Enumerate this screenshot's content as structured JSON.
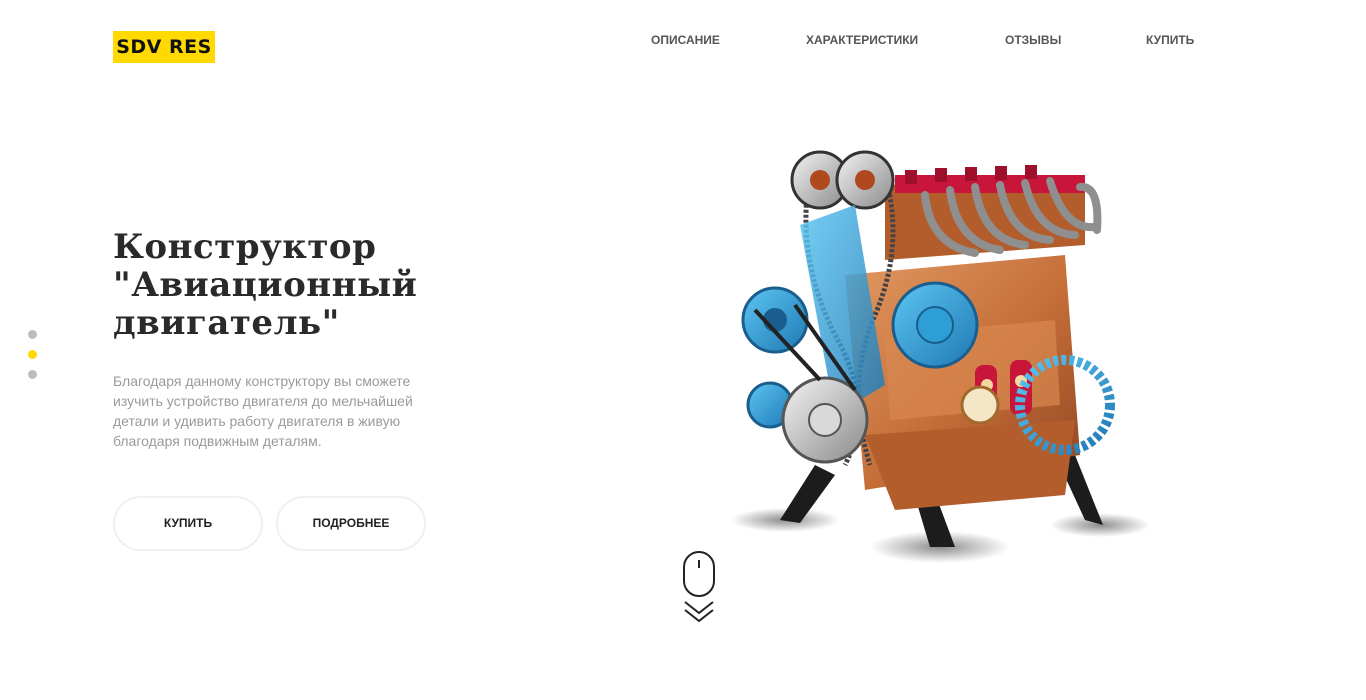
{
  "header": {
    "logo_text": "SDV RES",
    "nav": [
      {
        "label": "ОПИСАНИЕ"
      },
      {
        "label": "ХАРАКТЕРИСТИКИ"
      },
      {
        "label": "ОТЗЫВЫ"
      },
      {
        "label": "КУПИТЬ"
      }
    ]
  },
  "hero": {
    "title_lines": [
      "Конструктор",
      "\"Авиационный",
      "двигатель\""
    ],
    "description": "Благодаря данному конструктору вы сможете изучить устройство двигателя до мельчайшей детали и удивить работу двигателя в живую благодаря подвижным деталям.",
    "buy_label": "КУПИТЬ",
    "more_label": "ПОДРОБНЕЕ"
  },
  "slider": {
    "dot_count": 3,
    "active_index": 1
  },
  "colors": {
    "accent": "#ffd900",
    "engine_blue": "#2e9fd6",
    "engine_copper": "#c8703c",
    "engine_red": "#c8153a"
  },
  "icons": [
    "mouse-scroll-icon",
    "double-chevron-down-icon"
  ]
}
